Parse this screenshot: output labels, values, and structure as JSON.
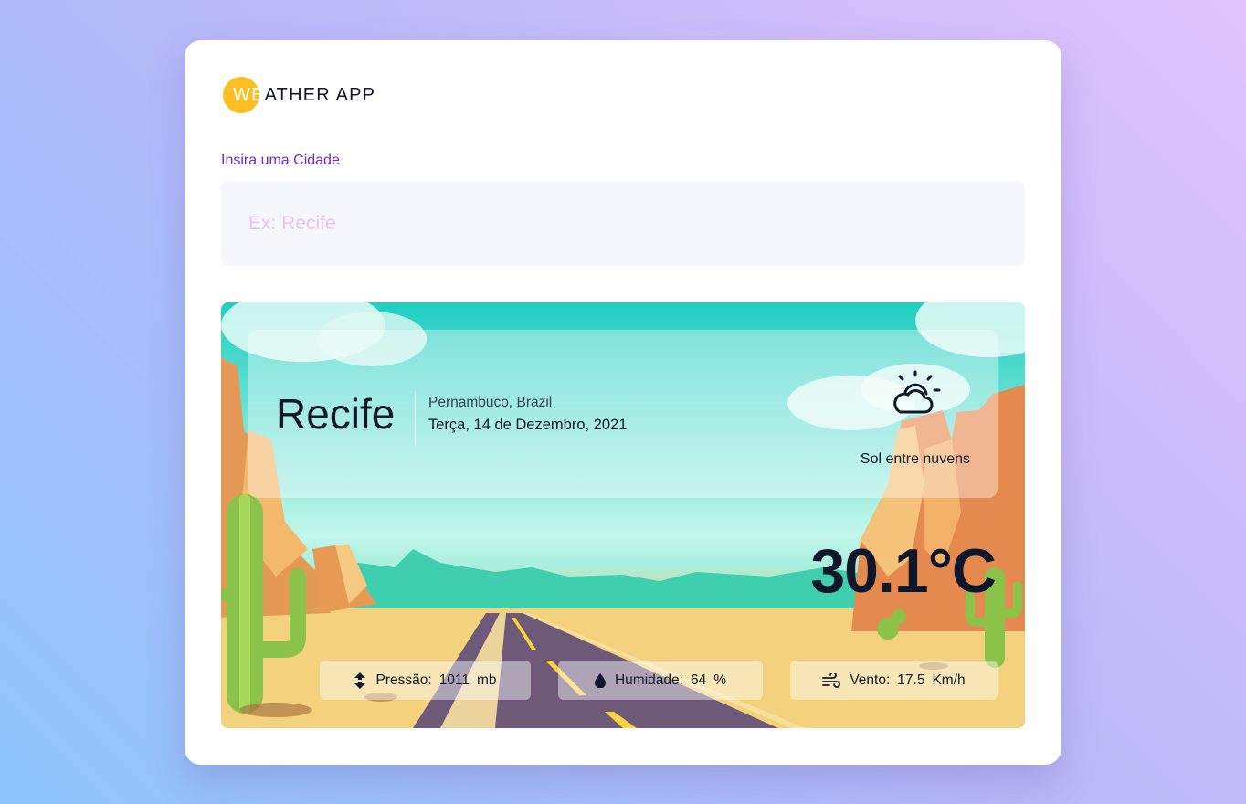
{
  "app": {
    "logo_part1": "WE",
    "logo_part2": "ATHER APP",
    "accent_color": "#fbbf24"
  },
  "search": {
    "label": "Insira uma Cidade",
    "placeholder": "Ex: Recife",
    "value": ""
  },
  "weather": {
    "city": "Recife",
    "region": "Pernambuco, Brazil",
    "date": "Terça, 14 de Dezembro, 2021",
    "condition": "Sol entre nuvens",
    "condition_icon": "partly-sunny-icon",
    "temperature": "30.1°C"
  },
  "stats": {
    "pressure": {
      "label": "Pressão:",
      "value": "1011",
      "unit": "mb",
      "icon": "pressure-icon"
    },
    "humidity": {
      "label": "Humidade:",
      "value": "64",
      "unit": "%",
      "icon": "droplet-icon"
    },
    "wind": {
      "label": "Vento:",
      "value": "17.5",
      "unit": "Km/h",
      "icon": "wind-icon"
    }
  }
}
